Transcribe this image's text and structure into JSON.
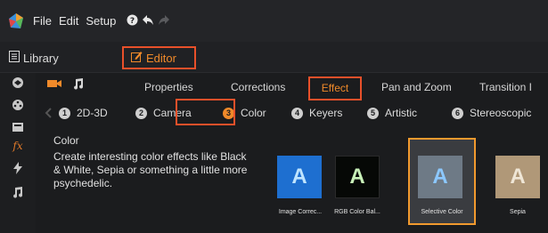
{
  "menubar": {
    "items": [
      "File",
      "Edit",
      "Setup"
    ],
    "icons": [
      "help-icon",
      "undo-icon",
      "redo-icon"
    ]
  },
  "modes": {
    "library": "Library",
    "editor": "Editor"
  },
  "tabs_row1": [
    "Properties",
    "Corrections",
    "Effect",
    "Pan and Zoom",
    "Transition I"
  ],
  "categories": [
    {
      "num": "1",
      "label": "2D-3D"
    },
    {
      "num": "2",
      "label": "Camera"
    },
    {
      "num": "3",
      "label": "Color"
    },
    {
      "num": "4",
      "label": "Keyers"
    },
    {
      "num": "5",
      "label": "Artistic"
    },
    {
      "num": "6",
      "label": "Stereoscopic"
    }
  ],
  "description": {
    "title": "Color",
    "text": "Create interesting color effects like Black & White, Sepia or something a little more psychedelic."
  },
  "thumbnails": [
    {
      "letter": "A",
      "label": "Image Correc..."
    },
    {
      "letter": "A",
      "label": "RGB Color Bal..."
    },
    {
      "letter": "A",
      "label": "Selective Color"
    },
    {
      "letter": "A",
      "label": "Sepia"
    }
  ],
  "colors": {
    "accent": "#f08a2a",
    "highlight_border": "#e8502a"
  }
}
